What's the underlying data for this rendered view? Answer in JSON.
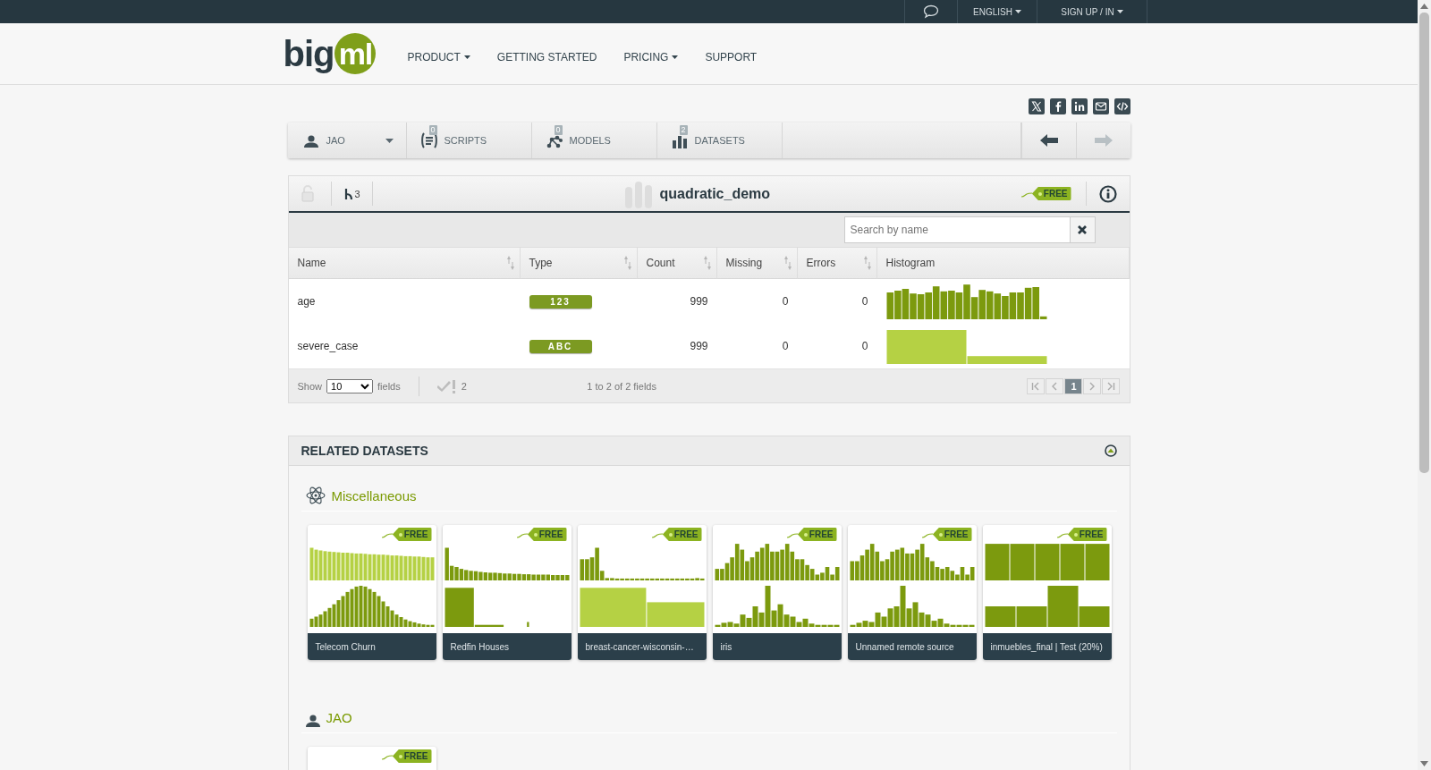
{
  "top_bar": {
    "items": [
      {
        "label": "ENGLISH",
        "dropdown": true
      },
      {
        "label": "SIGN UP / IN",
        "dropdown": true
      }
    ]
  },
  "header": {
    "logo": {
      "dark": "big",
      "green": "ml"
    },
    "nav": [
      {
        "label": "PRODUCT",
        "dropdown": true
      },
      {
        "label": "GETTING STARTED",
        "dropdown": false
      },
      {
        "label": "PRICING",
        "dropdown": true
      },
      {
        "label": "SUPPORT",
        "dropdown": false
      }
    ]
  },
  "toolbar": {
    "user": "JAO",
    "tabs": [
      {
        "kind": "scripts",
        "label": "SCRIPTS",
        "count": "0"
      },
      {
        "kind": "models",
        "label": "MODELS",
        "count": "0"
      },
      {
        "kind": "datasets",
        "label": "DATASETS",
        "count": "2"
      }
    ],
    "back_disabled": false,
    "forward_disabled": true
  },
  "dataset": {
    "forks": "3",
    "name": "quadratic_demo",
    "badge": "FREE",
    "search": {
      "placeholder": "Search by name"
    },
    "columns": [
      "Name",
      "Type",
      "Count",
      "Missing",
      "Errors",
      "Histogram"
    ],
    "rows": [
      {
        "name": "age",
        "type": "123",
        "count": "999",
        "missing": "0",
        "errors": "0"
      },
      {
        "name": "severe_case",
        "type": "ABC",
        "count": "999",
        "missing": "0",
        "errors": "0"
      }
    ],
    "footer": {
      "show_label": "Show",
      "page_size": "10",
      "fields_label": "fields",
      "valid_count": "2",
      "summary": "1 to 2 of 2 fields",
      "pages": [
        {
          "label": "1",
          "selected": true
        }
      ]
    }
  },
  "related": {
    "title": "RELATED DATASETS",
    "groups": [
      {
        "kind": "category",
        "title": "Miscellaneous",
        "cards": [
          {
            "name": "Telecom Churn",
            "badge": "FREE"
          },
          {
            "name": "Redfin Houses",
            "badge": "FREE"
          },
          {
            "name": "breast-cancer-wisconsin-…",
            "badge": "FREE"
          },
          {
            "name": "iris",
            "badge": "FREE"
          },
          {
            "name": "Unnamed remote source",
            "badge": "FREE"
          },
          {
            "name": "inmuebles_final | Test (20%)",
            "badge": "FREE"
          }
        ]
      },
      {
        "kind": "user",
        "title": "JAO",
        "cards": [
          {
            "badge": "FREE"
          }
        ]
      }
    ]
  }
}
